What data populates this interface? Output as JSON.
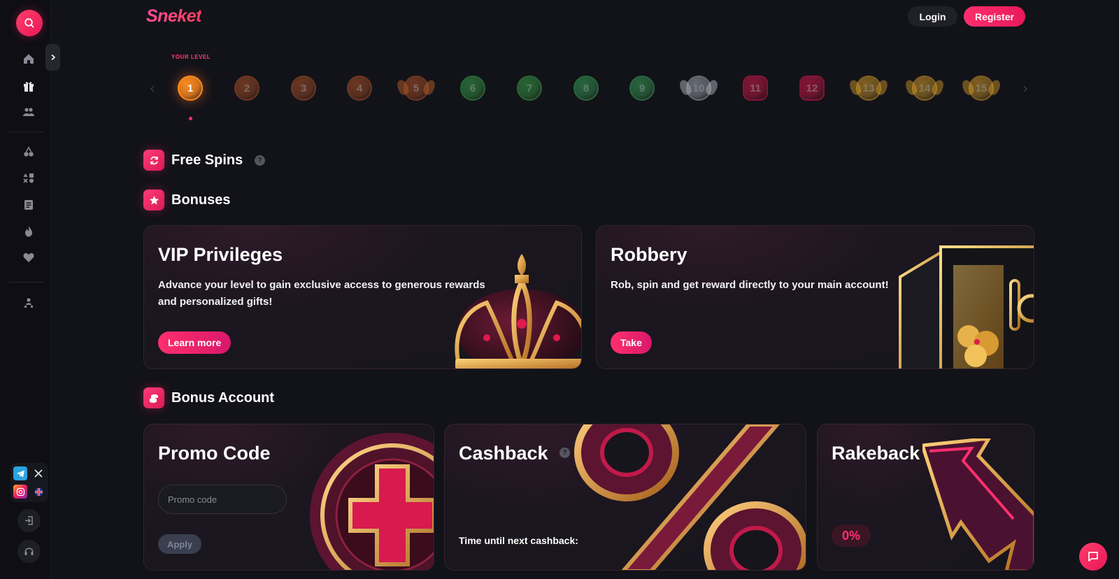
{
  "header": {
    "logo": "Sneket",
    "login_label": "Login",
    "register_label": "Register"
  },
  "levels": {
    "your_level_label": "YOUR LEVEL",
    "current": 1,
    "items": [
      "1",
      "2",
      "3",
      "4",
      "5",
      "6",
      "7",
      "8",
      "9",
      "10",
      "11",
      "12",
      "13",
      "14",
      "15"
    ]
  },
  "sections": {
    "free_spins": "Free Spins",
    "bonuses": "Bonuses",
    "bonus_account": "Bonus Account"
  },
  "bonuses": {
    "vip": {
      "title": "VIP Privileges",
      "text_line1": "Advance your level to gain exclusive access to generous rewards",
      "text_line2": "and personalized gifts!",
      "button": "Learn more"
    },
    "robbery": {
      "title": "Robbery",
      "text": "Rob, spin and get reward directly to your main account!",
      "button": "Take"
    }
  },
  "bonus_account": {
    "promo": {
      "title": "Promo Code",
      "placeholder": "Promo code",
      "button": "Apply"
    },
    "cashback": {
      "title": "Cashback",
      "note": "Time until next cashback:"
    },
    "rakeback": {
      "title": "Rakeback",
      "value": "0%"
    }
  },
  "sidebar": {
    "icons": [
      "search-icon",
      "home-icon",
      "gift-icon",
      "users-icon",
      "cherries-icon",
      "games-icon",
      "document-icon",
      "fire-icon",
      "heart-icon",
      "person-tree-icon"
    ],
    "social": [
      "telegram-icon",
      "x-icon",
      "instagram-icon",
      "uk-flag-icon"
    ],
    "bottom": [
      "login-icon",
      "headset-icon"
    ]
  },
  "colors": {
    "accent": "#ff2f6e",
    "background": "#121219",
    "sidebar": "#0e0e14"
  }
}
